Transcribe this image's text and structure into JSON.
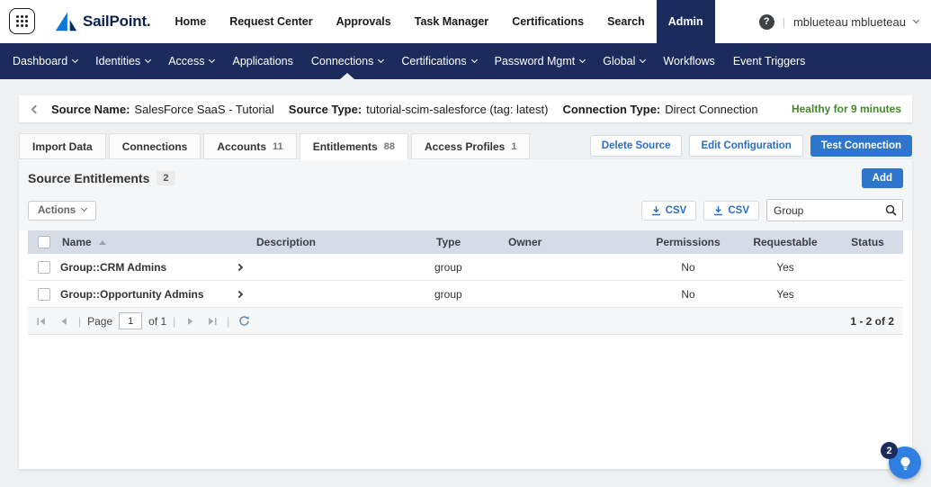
{
  "colors": {
    "navy": "#1b2b5c",
    "accent_blue": "#2e76cc",
    "link_blue": "#2a6fc7",
    "healthy_green": "#418a28",
    "table_header_bg": "#d5dce6"
  },
  "top_nav": {
    "brand": "SailPoint.",
    "items": [
      {
        "label": "Home",
        "active": false
      },
      {
        "label": "Request Center",
        "active": false
      },
      {
        "label": "Approvals",
        "active": false
      },
      {
        "label": "Task Manager",
        "active": false
      },
      {
        "label": "Certifications",
        "active": false
      },
      {
        "label": "Search",
        "active": false
      },
      {
        "label": "Admin",
        "active": true
      }
    ],
    "help_glyph": "?",
    "separator": "|",
    "user": "mblueteau mblueteau"
  },
  "admin_nav": {
    "items": [
      {
        "label": "Dashboard",
        "dropdown": true,
        "active": false
      },
      {
        "label": "Identities",
        "dropdown": true,
        "active": false
      },
      {
        "label": "Access",
        "dropdown": true,
        "active": false
      },
      {
        "label": "Applications",
        "dropdown": false,
        "active": false
      },
      {
        "label": "Connections",
        "dropdown": true,
        "active": true
      },
      {
        "label": "Certifications",
        "dropdown": true,
        "active": false
      },
      {
        "label": "Password Mgmt",
        "dropdown": true,
        "active": false
      },
      {
        "label": "Global",
        "dropdown": true,
        "active": false
      },
      {
        "label": "Workflows",
        "dropdown": false,
        "active": false
      },
      {
        "label": "Event Triggers",
        "dropdown": false,
        "active": false
      }
    ]
  },
  "source_header": {
    "source_name_label": "Source Name:",
    "source_name": "SalesForce SaaS - Tutorial",
    "source_type_label": "Source Type:",
    "source_type": "tutorial-scim-salesforce (tag: latest)",
    "connection_type_label": "Connection Type:",
    "connection_type": "Direct Connection",
    "health_status": "Healthy for 9 minutes"
  },
  "tabs": {
    "items": [
      {
        "label": "Import Data",
        "count": "",
        "active": false
      },
      {
        "label": "Connections",
        "count": "",
        "active": false
      },
      {
        "label": "Accounts",
        "count": "11",
        "active": false
      },
      {
        "label": "Entitlements",
        "count": "88",
        "active": true
      },
      {
        "label": "Access Profiles",
        "count": "1",
        "active": false
      }
    ],
    "actions": {
      "delete": "Delete Source",
      "edit": "Edit Configuration",
      "test": "Test Connection"
    }
  },
  "panel": {
    "title": "Source Entitlements",
    "count": "2",
    "add_label": "Add",
    "actions_label": "Actions",
    "csv_label": "CSV",
    "search_value": "Group"
  },
  "table": {
    "columns": {
      "name": "Name",
      "description": "Description",
      "type": "Type",
      "owner": "Owner",
      "permissions": "Permissions",
      "requestable": "Requestable",
      "status": "Status"
    },
    "rows": [
      {
        "name": "Group::CRM Admins",
        "description": "",
        "type": "group",
        "owner": "",
        "permissions": "No",
        "requestable": "Yes",
        "status": ""
      },
      {
        "name": "Group::Opportunity Admins",
        "description": "",
        "type": "group",
        "owner": "",
        "permissions": "No",
        "requestable": "Yes",
        "status": ""
      }
    ]
  },
  "pagination": {
    "page_label": "Page",
    "page_value": "1",
    "of_label": "of 1",
    "separator": "|",
    "range": "1 - 2 of 2"
  },
  "fab": {
    "badge": "2"
  }
}
